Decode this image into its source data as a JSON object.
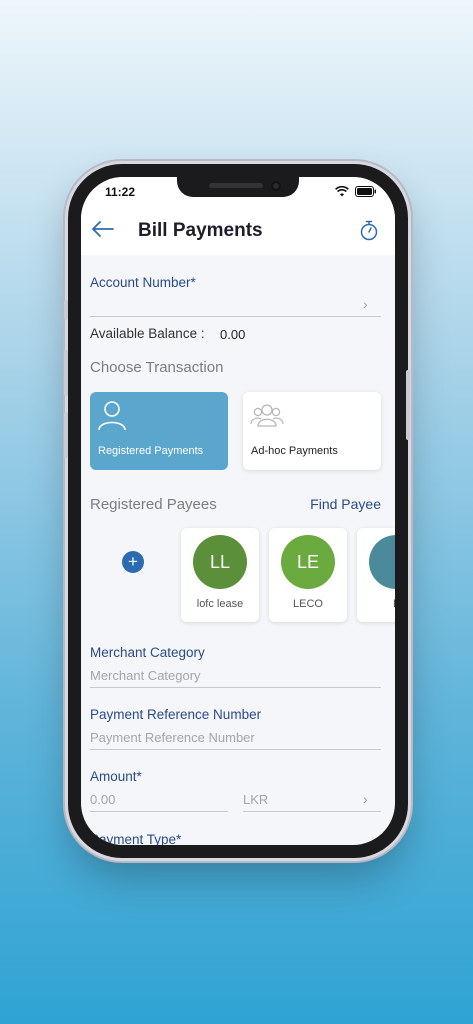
{
  "status": {
    "time": "11:22"
  },
  "header": {
    "title": "Bill Payments"
  },
  "account": {
    "label": "Account Number*",
    "balance_label": "Available Balance :",
    "balance_value": "0.00"
  },
  "transaction": {
    "heading": "Choose Transaction",
    "options": [
      {
        "label": "Registered Payments",
        "selected": true
      },
      {
        "label": "Ad-hoc Payments",
        "selected": false
      }
    ]
  },
  "payees": {
    "heading": "Registered Payees",
    "find_label": "Find Payee",
    "add_symbol": "+",
    "items": [
      {
        "initials": "LL",
        "name": "lofc lease",
        "color": "#5b8f3a"
      },
      {
        "initials": "LE",
        "name": "LECO",
        "color": "#6aaa3f"
      },
      {
        "initials": "",
        "name": "L",
        "color": "#4a8a9a"
      }
    ]
  },
  "form": {
    "merchant_label": "Merchant Category",
    "merchant_placeholder": "Merchant Category",
    "reference_label": "Payment Reference Number",
    "reference_placeholder": "Payment Reference Number",
    "amount_label": "Amount*",
    "amount_placeholder": "0.00",
    "currency": "LKR",
    "payment_type_label": "Payment Type*"
  },
  "colors": {
    "accent": "#2a4a8a",
    "primary_button": "#2b6cb0",
    "selected_card": "#5aa6cc"
  }
}
